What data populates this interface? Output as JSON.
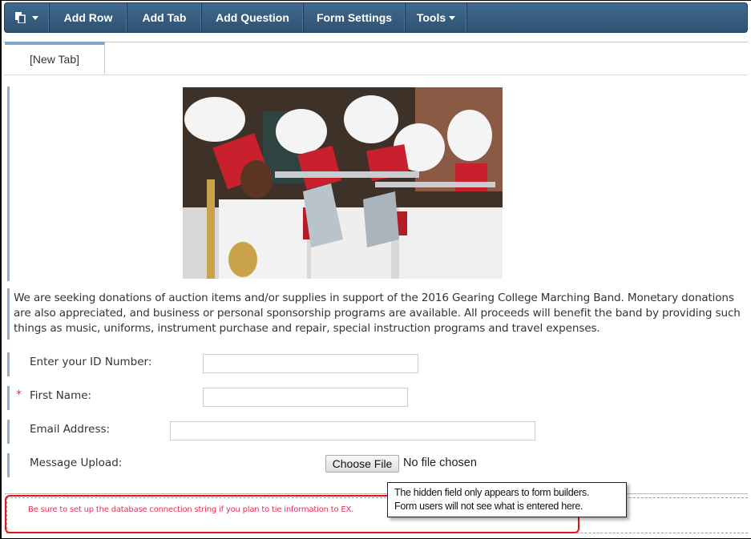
{
  "toolbar": {
    "items": [
      {
        "icon": "paste-page-icon",
        "label": "",
        "has_dropdown": true
      },
      {
        "label": "Add Row"
      },
      {
        "label": "Add Tab"
      },
      {
        "label": "Add Question"
      },
      {
        "label": "Form Settings"
      },
      {
        "label": "Tools",
        "has_dropdown": true
      }
    ]
  },
  "tabs": [
    {
      "label": "[New Tab]",
      "active": true
    }
  ],
  "banner_image": {
    "alt": "Marching band members in red and white uniforms playing trumpets and saxophone"
  },
  "intro_text": "We are seeking donations of auction items and/or supplies in support of the 2016 Gearing College Marching Band.  Monetary donations are also appreciated, and business or personal sponsorship programs are available.  All proceeds will benefit the band by providing such things as music, uniforms, instrument purchase and repair, special instruction programs and travel expenses.",
  "form": {
    "fields": [
      {
        "label": "Enter your ID Number:",
        "required": false,
        "type": "text",
        "value": ""
      },
      {
        "label": "First Name:",
        "required": true,
        "required_marker": "*",
        "type": "text",
        "value": ""
      },
      {
        "label": "Email Address:",
        "required": false,
        "type": "text",
        "value": ""
      },
      {
        "label": "Message Upload:",
        "required": false,
        "type": "file",
        "button_label": "Choose File",
        "status": "No file chosen"
      }
    ]
  },
  "hidden_field": {
    "note": "Be sure to set up the database connection string if you plan to tie information to EX."
  },
  "callout": {
    "line1": "The hidden field only appears to form builders.",
    "line2": "Form users will not see what is entered here."
  },
  "colors": {
    "toolbar": "#335a7c",
    "tab_accent": "#7ea6c9",
    "row_bar": "#8db0d0",
    "required": "#e0335a",
    "highlight": "#e8121a"
  }
}
